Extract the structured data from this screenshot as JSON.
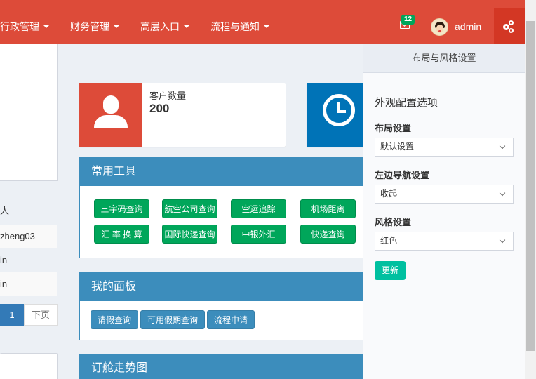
{
  "navbar": {
    "menu": [
      {
        "label": "行政管理"
      },
      {
        "label": "财务管理"
      },
      {
        "label": "高层入口"
      },
      {
        "label": "流程与通知"
      }
    ],
    "mail_count": "12",
    "username": "admin",
    "bg_color": "#dd4b39"
  },
  "left": {
    "rows": [
      "人",
      "zheng03",
      "in",
      "in"
    ],
    "pager_current": "1",
    "pager_next": "下页"
  },
  "info_boxes": [
    {
      "label": "客户数量",
      "value": "200",
      "icon": "user-icon",
      "color": "#dd4b39"
    },
    {
      "label": "",
      "value": "",
      "icon": "clock-icon",
      "color": "#0073b7"
    }
  ],
  "tools_panel": {
    "title": "常用工具",
    "buttons": [
      "三字码查询",
      "航空公司查询",
      "空运追踪",
      "机场距离",
      "汇 率 换 算",
      "国际快递查询",
      "中银外汇",
      "快递查询"
    ]
  },
  "my_panel": {
    "title": "我的面板",
    "buttons": [
      "请假查询",
      "可用假期查询",
      "流程申请"
    ]
  },
  "trend_panel": {
    "title": "订舱走势图"
  },
  "settings": {
    "title": "布局与风格设置",
    "heading": "外观配置选项",
    "layout_label": "布局设置",
    "layout_value": "默认设置",
    "sidebar_label": "左边导航设置",
    "sidebar_value": "收起",
    "style_label": "风格设置",
    "style_value": "红色",
    "update_button": "更新"
  }
}
